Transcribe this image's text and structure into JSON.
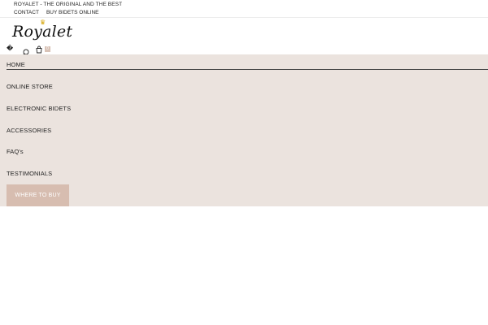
{
  "topbar": {
    "tagline": "ROYALET - THE ORIGINAL AND THE BEST",
    "links": [
      "CONTACT",
      "BUY BIDETS ONLINE"
    ]
  },
  "header": {
    "logo_text": "Royalet",
    "crown_glyph": "♛",
    "missing_glyph": "�",
    "cart_count": "0"
  },
  "nav": {
    "items": [
      "HOME",
      "ONLINE STORE",
      "ELECTRONIC BIDETS",
      "ACCESSORIES",
      "FAQ's",
      "TESTIMONIALS"
    ],
    "cta_label": "WHERE TO BUY"
  },
  "colors": {
    "nav_background": "#ebe3de",
    "cta_background": "#d7bdb0",
    "crown": "#d4a200"
  },
  "icons": [
    "search-icon",
    "cart-icon",
    "crown-icon"
  ]
}
